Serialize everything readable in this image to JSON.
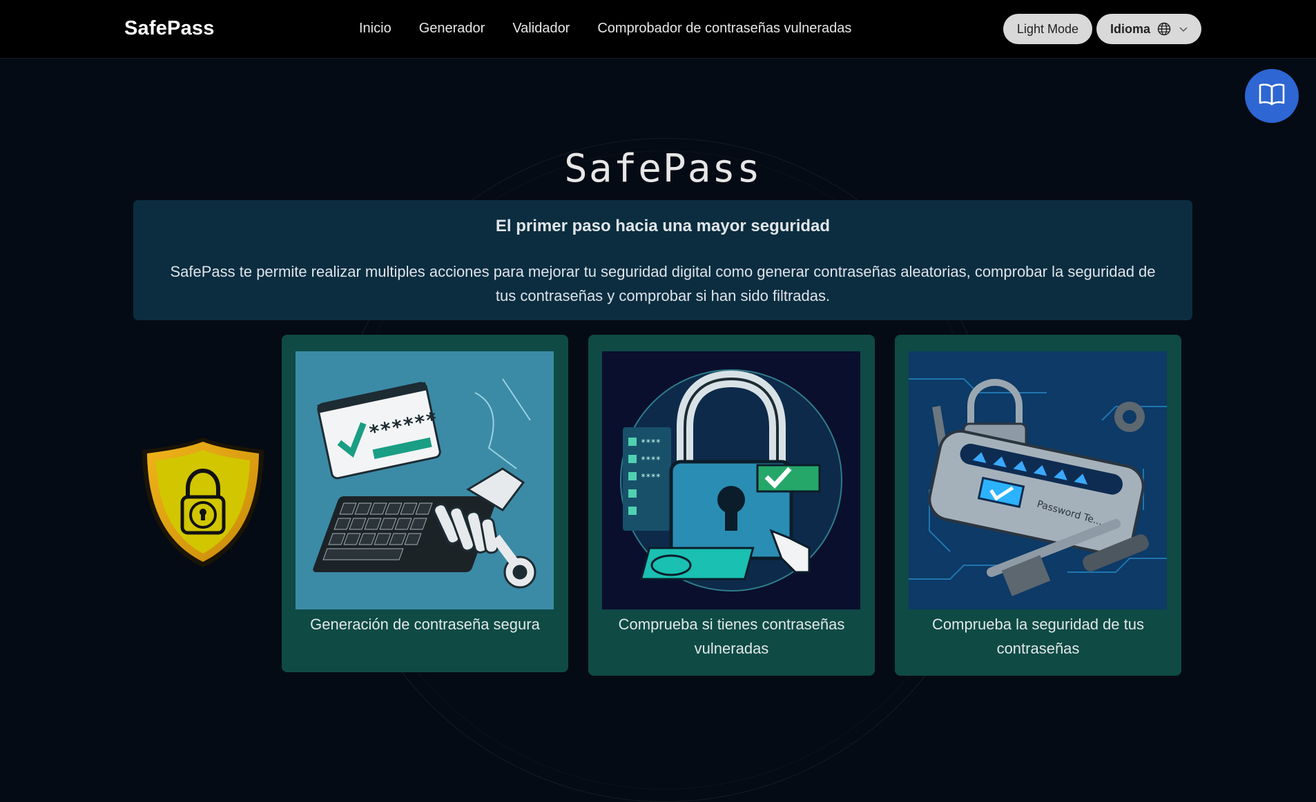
{
  "navbar": {
    "brand": "SafePass",
    "links": [
      "Inicio",
      "Generador",
      "Validador",
      "Comprobador de contraseñas vulneradas"
    ],
    "light_mode_label": "Light Mode",
    "language_label": "Idioma"
  },
  "hero": {
    "title": "SafePass",
    "subtitle": "El primer paso hacia una mayor seguridad",
    "description": "SafePass te permite realizar multiples acciones para mejorar tu seguridad digital como generar contraseñas aleatorias, comprobar la seguridad de tus contraseñas y comprobar si han sido filtradas."
  },
  "cards": [
    {
      "caption": "Generación de contraseña segura"
    },
    {
      "caption": "Comprueba si tienes contraseñas vulneradas"
    },
    {
      "caption": "Comprueba la seguridad de tus contraseñas"
    }
  ],
  "colors": {
    "background": "#050b14",
    "navbar": "#000000",
    "intro_box": "#0c2d40",
    "card": "#0f4a45",
    "guide_button": "#2e66d3",
    "shield_gold": "#d4a017",
    "shield_yellow": "#d4c800"
  },
  "icons": {
    "language": "globe-icon",
    "dropdown": "chevron-down-icon",
    "guide": "open-book-icon",
    "logo": "shield-lock-icon"
  }
}
